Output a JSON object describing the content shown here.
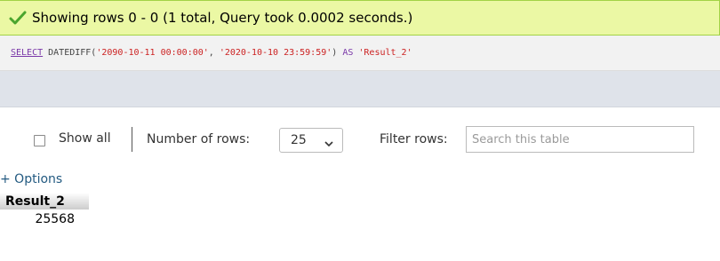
{
  "message": {
    "text": "Showing rows 0 - 0 (1 total, Query took 0.0002 seconds.)",
    "icon": "checkmark-icon",
    "bg_color": "#ebf8a4"
  },
  "sql": {
    "select_kw": "SELECT",
    "function_open": " DATEDIFF(",
    "arg1": "'2090-10-11 00:00:00'",
    "separator": ", ",
    "arg2": "'2020-10-10 23:59:59'",
    "close": ") ",
    "as_kw": "AS",
    "alias": " 'Result_2'"
  },
  "nav": {
    "show_all_label": "Show all",
    "number_of_rows_label": "Number of rows:",
    "rows_value": "25",
    "filter_label": "Filter rows:",
    "search_placeholder": "Search this table"
  },
  "options_label": "+ Options",
  "table": {
    "columns": [
      "Result_2"
    ],
    "rows": [
      [
        "25568"
      ]
    ]
  }
}
